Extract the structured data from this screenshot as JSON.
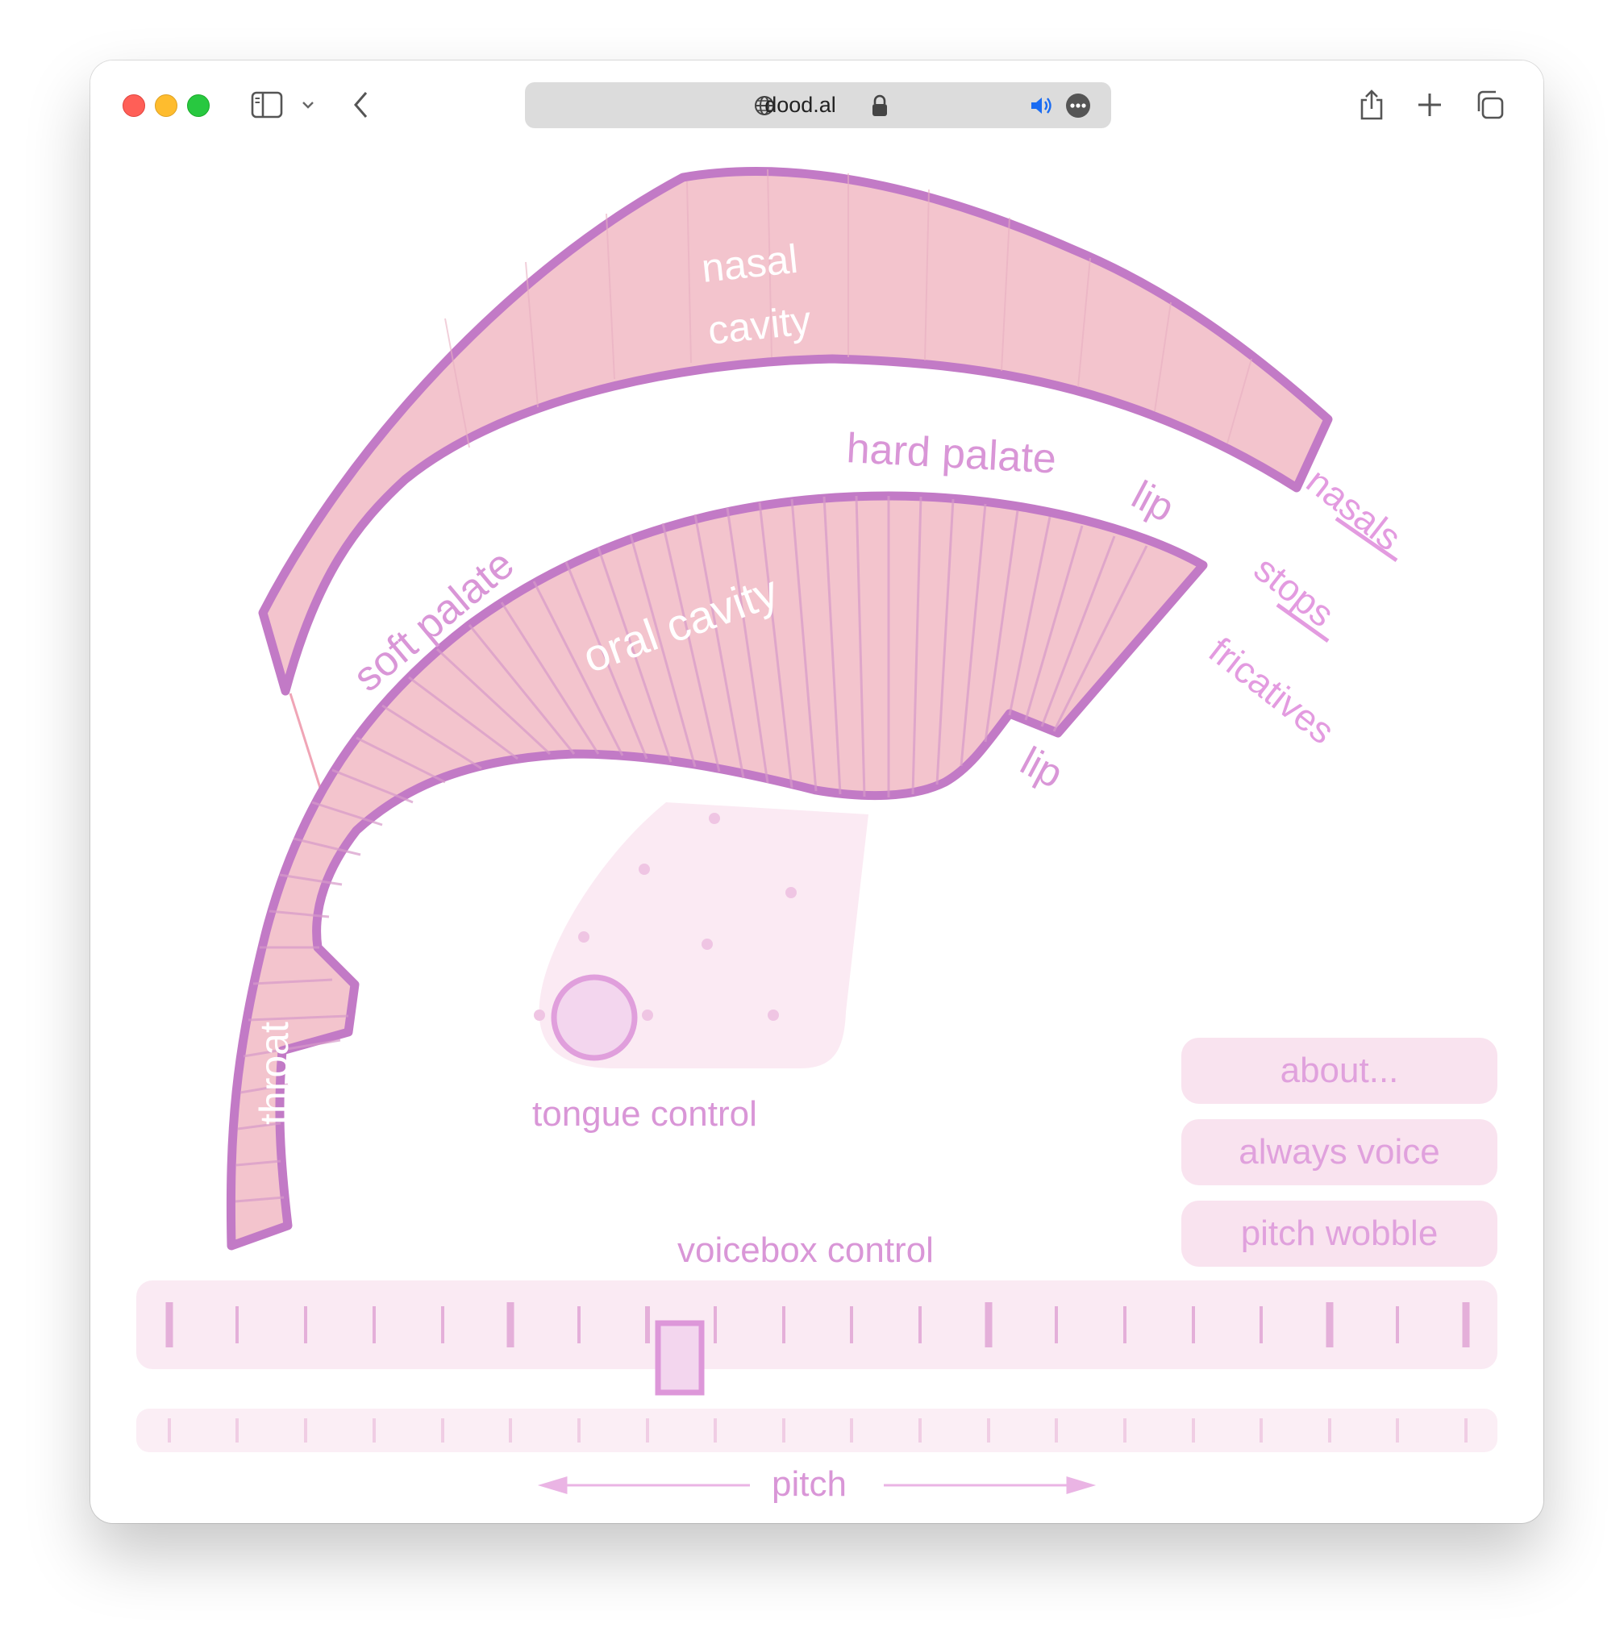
{
  "browser": {
    "url": "dood.al"
  },
  "diagram": {
    "nasal_cavity_line1": "nasal",
    "nasal_cavity_line2": "cavity",
    "hard_palate": "hard palate",
    "soft_palate": "soft palate",
    "oral_cavity": "oral  cavity",
    "lip_top": "lip",
    "lip_bottom": "lip",
    "throat": "throat",
    "nasals": "nasals",
    "stops": "stops",
    "fricatives": "fricatives"
  },
  "tongue_control": {
    "label": "tongue control"
  },
  "voicebox_control": {
    "label": "voicebox control"
  },
  "pitch": {
    "label": "pitch"
  },
  "buttons": {
    "about": "about...",
    "always_voice": "always voice",
    "pitch_wobble": "pitch wobble"
  },
  "colors": {
    "tract_fill": "#f3c4cd",
    "tract_stroke": "#c27ac6",
    "label_pink": "#e39be0",
    "panel_bg": "#faeaf3"
  }
}
